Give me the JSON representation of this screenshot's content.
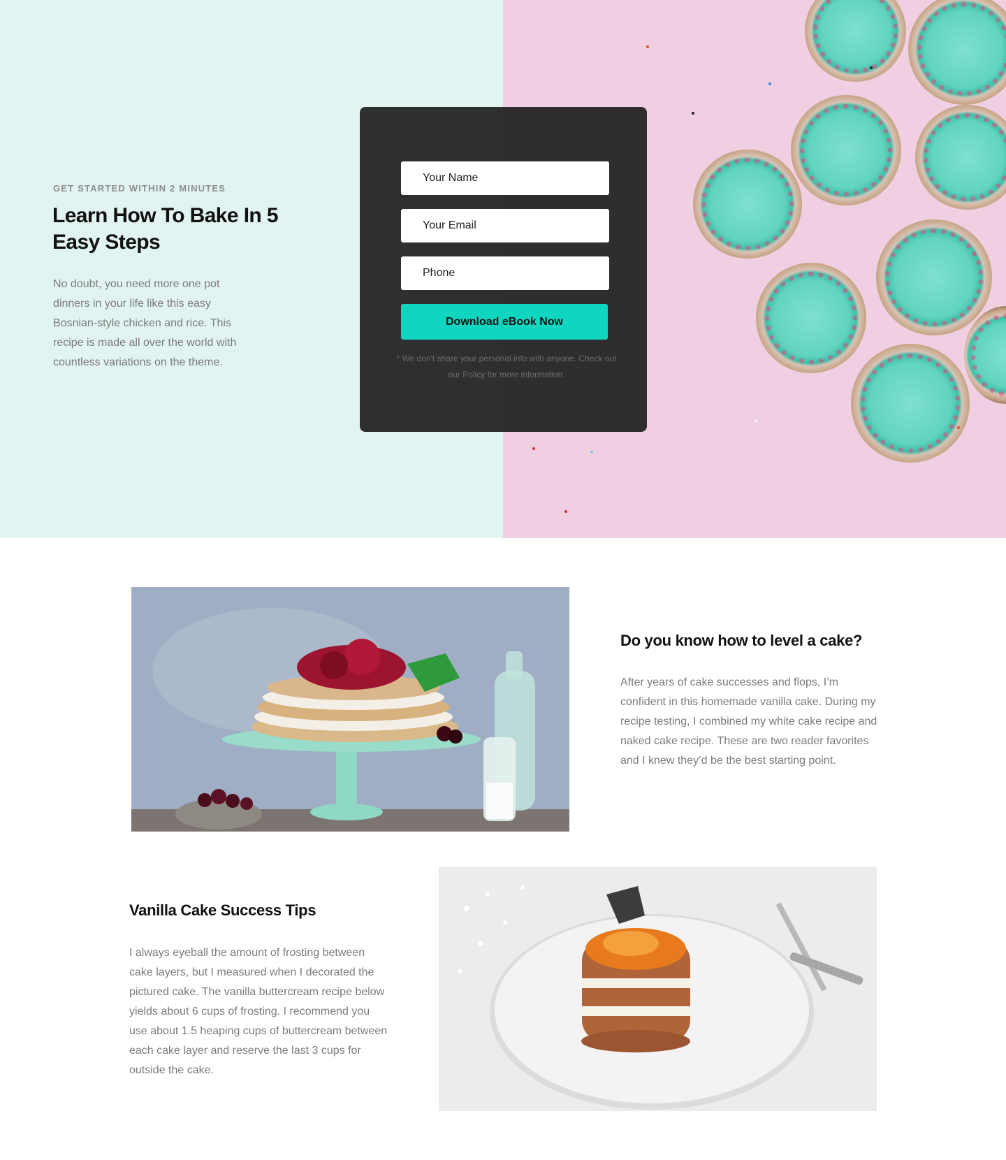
{
  "hero": {
    "eyebrow": "GET STARTED WITHIN 2 MINUTES",
    "title": "Learn How To Bake In 5 Easy Steps",
    "text": "No doubt, you need more one pot dinners in your life like this easy Bosnian-style chicken and rice. This recipe is made all over the world with countless variations on the theme.",
    "image_icon": "cupcakes-image",
    "colors": {
      "left_bg": "#e2f4f1",
      "right_bg": "#f0cfe2",
      "frosting": "#62d4c0"
    }
  },
  "form": {
    "name_placeholder": "Your Name",
    "email_placeholder": "Your Email",
    "phone_placeholder": "Phone",
    "submit_label": "Download eBook Now",
    "disclaimer": "* We don't share your personal info with anyone. Check out our Policy for more information.",
    "colors": {
      "card_bg": "#242424",
      "button": "#10d6c0"
    }
  },
  "features": [
    {
      "title": "Do you know how to level a cake?",
      "text": "After years of cake successes and flops, I’m confident in this homemade vanilla cake. During my recipe testing, I combined my white cake recipe and naked cake recipe. These are two reader favorites and I knew they’d be the best starting point.",
      "image_icon": "layered-cake-with-cherries-image"
    },
    {
      "title": "Vanilla Cake Success Tips",
      "text": "I always eyeball the amount of frosting between cake layers, but I measured when I decorated the pictured cake. The vanilla buttercream recipe below yields about 6 cups of frosting. I recommend you use about 1.5 heaping cups of buttercream between each cake layer and reserve the last 3 cups for outside the cake.",
      "image_icon": "small-layer-cake-on-plate-image"
    }
  ]
}
